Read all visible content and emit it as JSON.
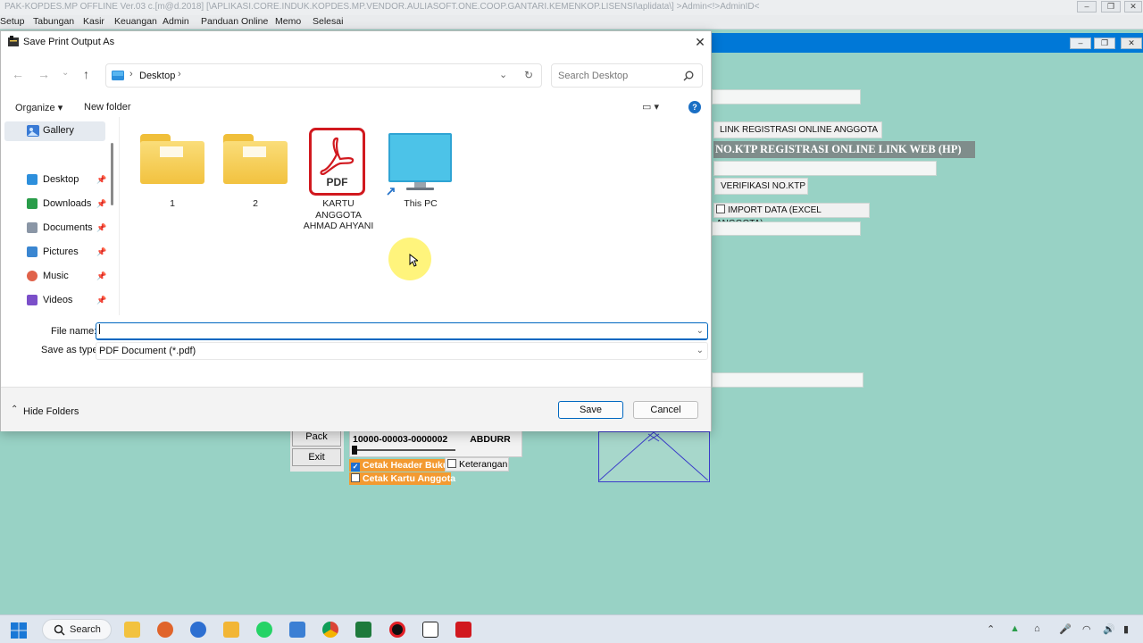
{
  "app": {
    "title": "PAK-KOPDES.MP OFFLINE Ver.03 c.[m@d.2018] [\\APLIKASI.CORE.INDUK.KOPDES.MP.VENDOR.AULIASOFT.ONE.COOP.GANTARI.KEMENKOP.LISENSI\\aplidata\\] >Admin<!>AdminID<",
    "menu": [
      "Setup",
      "Tabungan",
      "Kasir",
      "Keuangan",
      "Admin",
      "Panduan Online",
      "Memo",
      "Selesai"
    ]
  },
  "form": {
    "link_registrasi_button": "LINK REGISTRASI ONLINE ANGGOTA",
    "ktp_label": "NO.KTP REGISTRASI ONLINE LINK WEB (HP)",
    "verifikasi_button": "VERIFIKASI NO.KTP",
    "import_checkbox_label": "IMPORT DATA  (EXCEL ANGGOTA)",
    "pack_button": "Pack",
    "exit_button": "Exit",
    "member_number": "10000-00003-0000002",
    "member_name": "ABDURR",
    "cetak_header_label": "Cetak Header Buku",
    "keterangan_label": "Keterangan",
    "cetak_kartu_label": "Cetak Kartu Anggota"
  },
  "dialog": {
    "title": "Save Print Output As",
    "breadcrumb": [
      "Desktop"
    ],
    "search_placeholder": "Search Desktop",
    "toolbar": {
      "organize": "Organize",
      "new_folder": "New folder"
    },
    "nav": {
      "gallery": "Gallery",
      "items": [
        {
          "label": "Desktop",
          "icon": "desktop-icon",
          "color": "#2d8fdc"
        },
        {
          "label": "Downloads",
          "icon": "download-icon",
          "color": "#2a9d4a"
        },
        {
          "label": "Documents",
          "icon": "documents-icon",
          "color": "#8a96a6"
        },
        {
          "label": "Pictures",
          "icon": "pictures-icon",
          "color": "#3a86d1"
        },
        {
          "label": "Music",
          "icon": "music-icon",
          "color": "#e0624a"
        },
        {
          "label": "Videos",
          "icon": "videos-icon",
          "color": "#7b4fc9"
        }
      ]
    },
    "files": [
      {
        "name": "1",
        "type": "folder"
      },
      {
        "name": "2",
        "type": "folder"
      },
      {
        "name": "KARTU ANGGOTA AHMAD AHYANI",
        "type": "pdf",
        "badge": "PDF"
      },
      {
        "name": "This PC",
        "type": "shortcut"
      }
    ],
    "file_name_label": "File name:",
    "file_name_value": "",
    "save_type_label": "Save as type:",
    "save_type_value": "PDF Document (*.pdf)",
    "hide_folders": "Hide Folders",
    "save_button": "Save",
    "cancel_button": "Cancel"
  },
  "taskbar": {
    "search_label": "Search"
  },
  "colors": {
    "app_background": "#98d2c5",
    "accent": "#0067c0",
    "orange_label": "#f39a31",
    "pdf_red": "#d1191f"
  }
}
